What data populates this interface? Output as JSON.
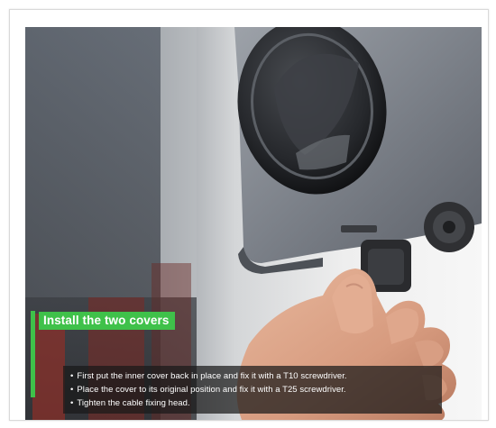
{
  "caption": {
    "title": "Install the two covers",
    "bullet_glyph": "•",
    "steps": [
      "First put the inner cover back in place and fix it with a T10 screwdriver.",
      "Place the cover to its original position and fix it with a T25 screwdriver.",
      "Tighten the cable fixing head."
    ]
  },
  "colors": {
    "accent": "#3fc14a",
    "caption_text": "#ffffff",
    "caption_background": "#191919"
  }
}
